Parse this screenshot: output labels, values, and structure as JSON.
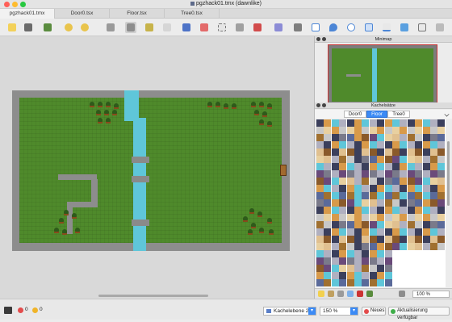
{
  "window": {
    "title": "pgzhack01.tmx (dawnlike)"
  },
  "tabs": [
    {
      "label": "pgzhack01.tmx"
    },
    {
      "label": "Door0.tsx"
    },
    {
      "label": "Floor.tsx"
    },
    {
      "label": "Tree0.tsx"
    }
  ],
  "panels": {
    "minimap": {
      "title": "Minimap"
    },
    "tilesets": {
      "title": "Kachelsätze",
      "tabs": [
        "Door0",
        "Floor",
        "Tree0"
      ],
      "active_tab": "Floor",
      "zoom": "100 %"
    }
  },
  "statusbar": {
    "errors": "0",
    "warnings": "0",
    "layer_select": "Kachelebene 2",
    "zoom_select": "150 %",
    "news_button": "Neues",
    "update_button": "Aktualisierung verfügbar"
  },
  "colors": {
    "accent": "#3b8af5",
    "grass": "#4f8a2b",
    "water": "#5fc6d9",
    "stone": "#8d8d8d"
  }
}
